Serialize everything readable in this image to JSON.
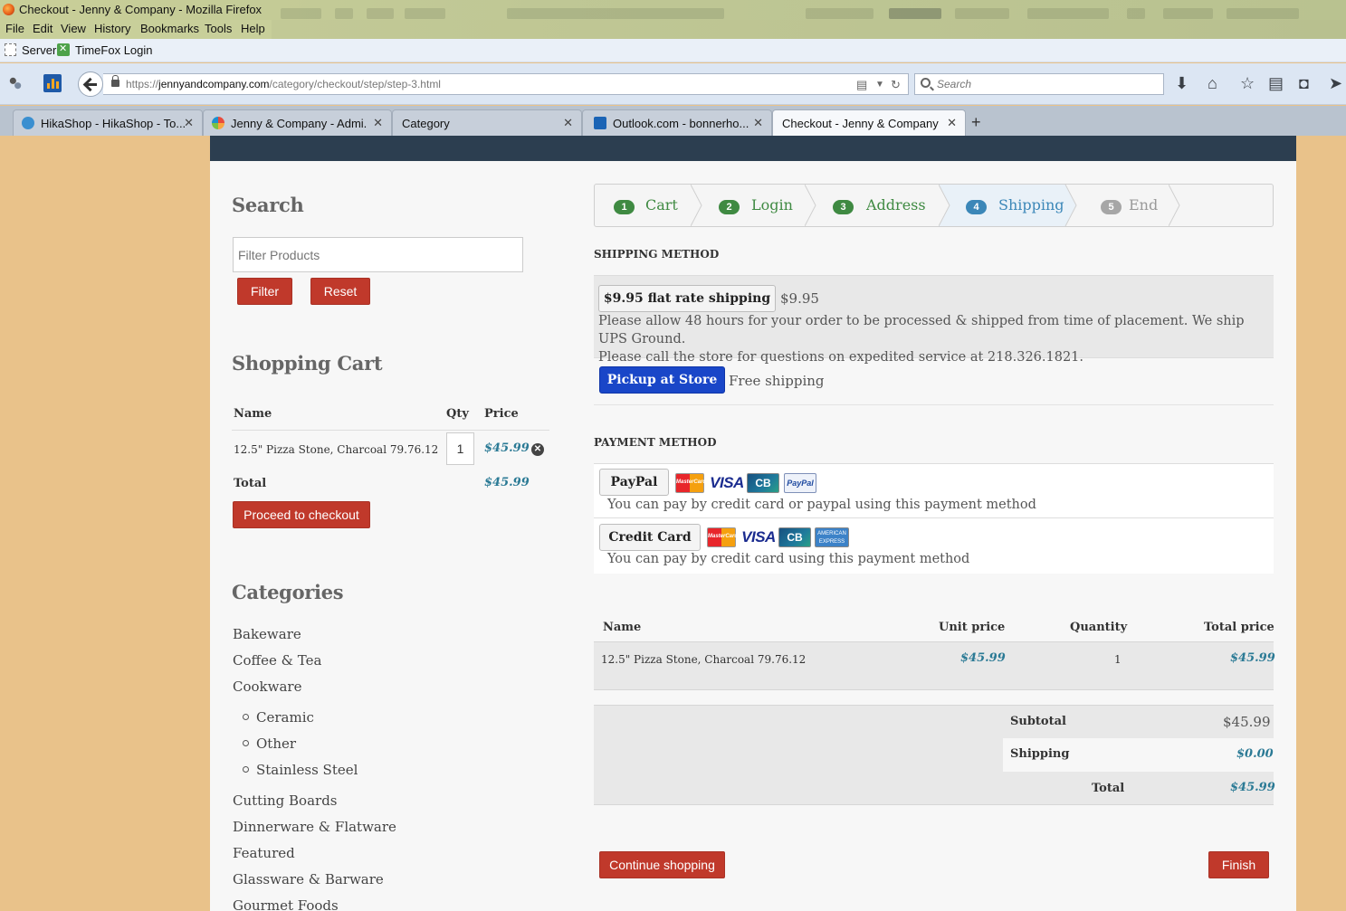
{
  "window": {
    "title": "Checkout - Jenny & Company - Mozilla Firefox"
  },
  "menu": [
    "File",
    "Edit",
    "View",
    "History",
    "Bookmarks",
    "Tools",
    "Help"
  ],
  "bookmarks": [
    "Server",
    "TimeFox Login"
  ],
  "nav": {
    "url_prefix": "https://",
    "url_host": "jennyandcompany.com",
    "url_path": "/category/checkout/step/step-3.html",
    "search_placeholder": "Search"
  },
  "tabs": [
    {
      "label": "HikaShop - HikaShop - To...",
      "icon": "hikashop-icon"
    },
    {
      "label": "Jenny & Company - Admi...",
      "icon": "joomla-icon"
    },
    {
      "label": "Category",
      "icon": ""
    },
    {
      "label": "Outlook.com - bonnerho...",
      "icon": "outlook-icon"
    },
    {
      "label": "Checkout - Jenny & Company",
      "icon": ""
    }
  ],
  "sidebar": {
    "search_title": "Search",
    "filter_placeholder": "Filter Products",
    "filter_btn": "Filter",
    "reset_btn": "Reset",
    "cart_title": "Shopping Cart",
    "cart_cols": {
      "name": "Name",
      "qty": "Qty",
      "price": "Price"
    },
    "cart_item": {
      "name": "12.5\" Pizza Stone, Charcoal 79.76.12",
      "qty": "1",
      "price": "$45.99"
    },
    "cart_total_label": "Total",
    "cart_total": "$45.99",
    "checkout_btn": "Proceed to checkout",
    "categories_title": "Categories",
    "categories": [
      "Bakeware",
      "Coffee & Tea",
      "Cookware"
    ],
    "cookware_sub": [
      "Ceramic",
      "Other",
      "Stainless Steel"
    ],
    "categories_more": [
      "Cutting Boards",
      "Dinnerware & Flatware",
      "Featured",
      "Glassware & Barware",
      "Gourmet Foods"
    ]
  },
  "wizard": {
    "steps": [
      {
        "num": "1",
        "label": "Cart",
        "state": "done"
      },
      {
        "num": "2",
        "label": "Login",
        "state": "done"
      },
      {
        "num": "3",
        "label": "Address",
        "state": "done"
      },
      {
        "num": "4",
        "label": "Shipping",
        "state": "active"
      },
      {
        "num": "5",
        "label": "End",
        "state": "todo"
      }
    ]
  },
  "shipping": {
    "title": "SHIPPING METHOD",
    "flat_btn": "$9.95 flat rate shipping",
    "flat_price": "$9.95",
    "flat_desc_1": "Please allow 48 hours for your order to be processed & shipped from time of placement. We ship UPS Ground.",
    "flat_desc_2": "Please call the store for questions on expedited service at 218.326.1821.",
    "pickup_btn": "Pickup at Store",
    "pickup_price": "Free shipping"
  },
  "payment": {
    "title": "PAYMENT METHOD",
    "paypal_btn": "PayPal",
    "paypal_desc": "You can pay by credit card or paypal using this payment method",
    "cc_btn": "Credit Card",
    "cc_desc": "You can pay by credit card using this payment method"
  },
  "order": {
    "cols": {
      "name": "Name",
      "unit": "Unit price",
      "qty": "Quantity",
      "total": "Total price"
    },
    "item": {
      "name": "12.5\" Pizza Stone, Charcoal 79.76.12",
      "unit": "$45.99",
      "qty": "1",
      "total": "$45.99"
    },
    "subtotal_label": "Subtotal",
    "subtotal": "$45.99",
    "shipping_label": "Shipping",
    "shipping": "$0.00",
    "total_label": "Total",
    "total": "$45.99"
  },
  "actions": {
    "continue_btn": "Continue shopping",
    "finish_btn": "Finish"
  },
  "colors": {
    "step_done": "#3f8a42",
    "step_active": "#3b87b8",
    "step_todo": "#a6a6a6",
    "red_button": "#c0392b",
    "blue_button": "#1946c8",
    "price": "#2b7a95"
  }
}
